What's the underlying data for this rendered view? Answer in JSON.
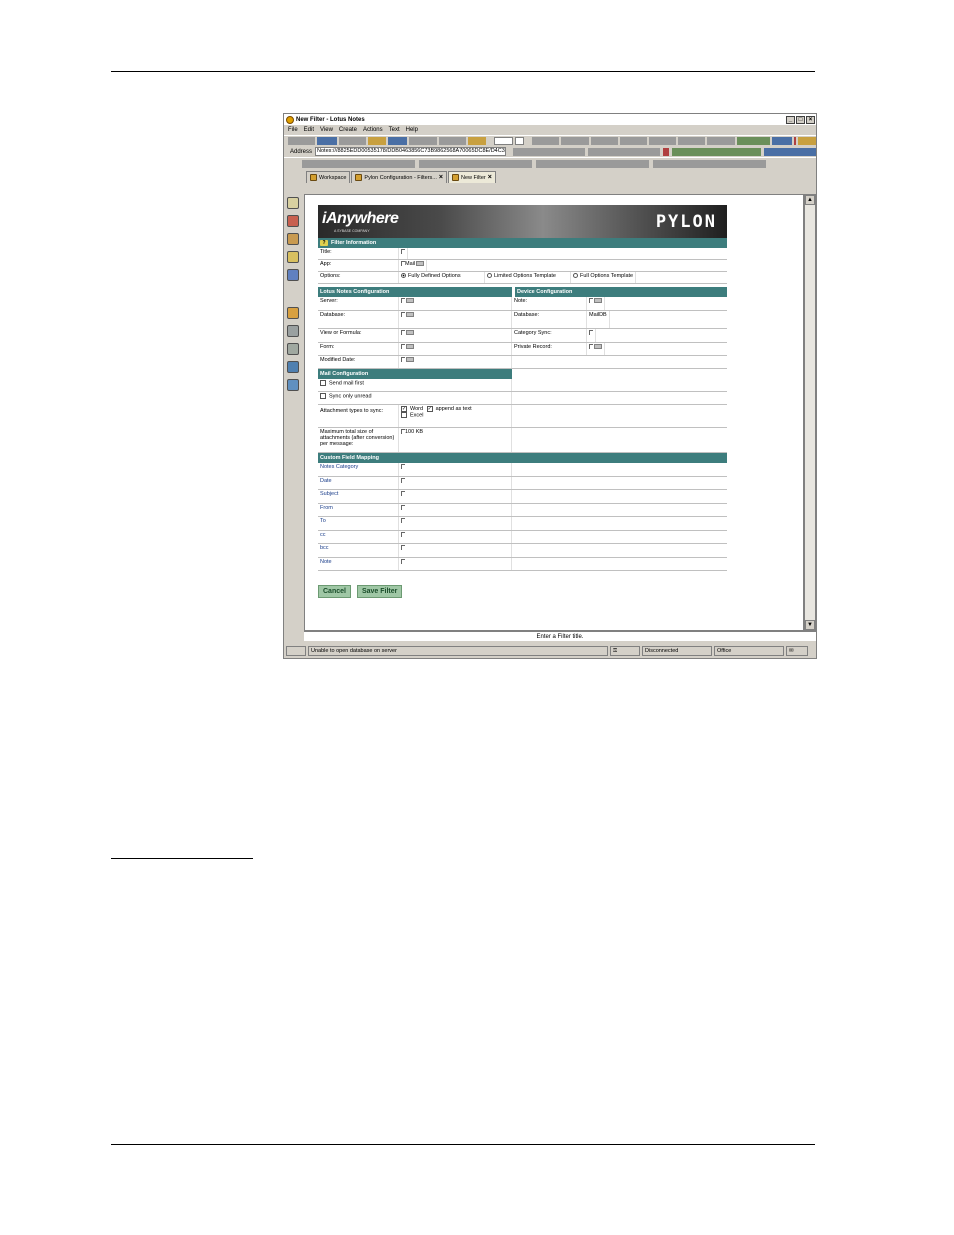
{
  "window": {
    "title": "New Filter - Lotus Notes",
    "menu": [
      "File",
      "Edit",
      "View",
      "Create",
      "Actions",
      "Text",
      "Help"
    ],
    "address_label": "Address",
    "address_value": "Notes:///8825EDD00535178/DDB0463856C73B9862568A70065DC8E/D4C3C128FA7FDD88258(",
    "tabs": [
      "Workspace",
      "Pylon Configuration - Filters...",
      "New Filter"
    ]
  },
  "banner": {
    "brand": "iAnywhere",
    "tagline": "A SYBASE COMPANY",
    "product": "PYLON"
  },
  "filter_info": {
    "heading": "Filter Information",
    "title_label": "Title:",
    "app_label": "App:",
    "app_value": "Mail",
    "options_label": "Options:",
    "options": [
      "Fully Defined Options",
      "Limited Options Template",
      "Full Options Template"
    ]
  },
  "lotus_config": {
    "heading": "Lotus Notes Configuration",
    "server_label": "Server:",
    "database_label": "Database:",
    "view_label": "View or Formula:",
    "form_label": "Form:",
    "modified_label": "Modified Date:"
  },
  "device_config": {
    "heading": "Device Configuration",
    "note_label": "Note:",
    "database_label": "Database:",
    "database_value": "MailDB",
    "category_label": "Category Sync:",
    "private_label": "Private Record:"
  },
  "mail_config": {
    "heading": "Mail Configuration",
    "send_mail_first": "Send mail first",
    "sync_only_unread": "Sync only unread",
    "attachment_label": "Attachment types to sync:",
    "word": "Word",
    "append_as_text": "append as text",
    "excel": "Excel",
    "max_size_label": "Maximum total size of attachments (after conversion) per message:",
    "max_size_value": "100",
    "max_size_unit": "KB"
  },
  "custom_mapping": {
    "heading": "Custom Field Mapping",
    "fields": [
      "Notes Category",
      "Date",
      "Subject",
      "From",
      "To",
      "cc",
      "bcc",
      "Note"
    ]
  },
  "buttons": {
    "cancel": "Cancel",
    "save": "Save Filter"
  },
  "status": {
    "message": "Enter a Filter title.",
    "left": "Unable to open database  on server",
    "connection": "Disconnected",
    "location": "Office"
  }
}
